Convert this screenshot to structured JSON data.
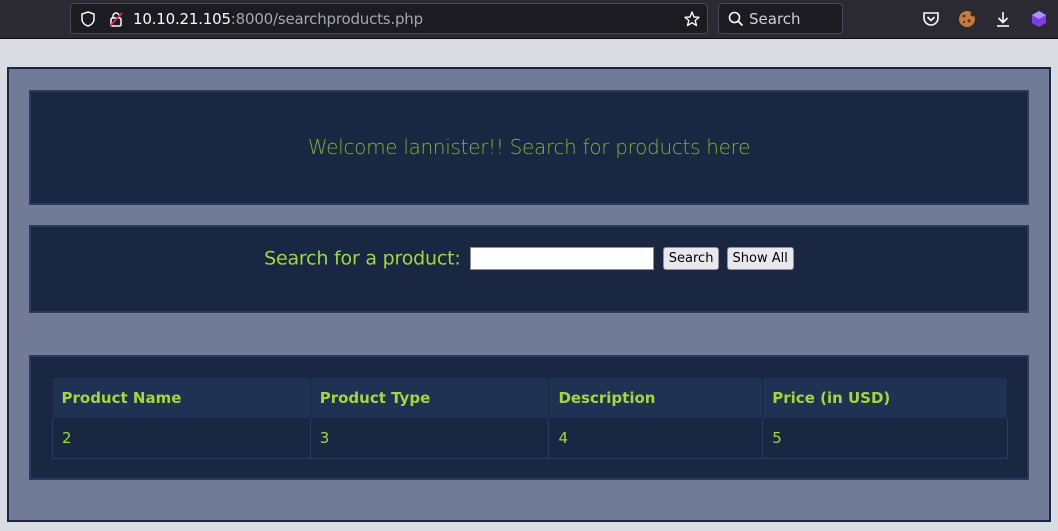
{
  "browser": {
    "url_host": "10.10.21.105",
    "url_rest": ":8000/searchproducts.php",
    "search_placeholder": "Search",
    "icons": [
      "shield-icon",
      "insecure-lock-icon",
      "bookmark-star-icon",
      "search-icon",
      "pocket-icon",
      "cookie-extension-icon",
      "download-icon",
      "extension-icon"
    ]
  },
  "page": {
    "welcome": "Welcome lannister!! Search for products here",
    "search_label": "Search for a product:",
    "search_value": "",
    "search_button": "Search",
    "show_all_button": "Show All",
    "table": {
      "headers": [
        "Product Name",
        "Product Type",
        "Description",
        "Price (in USD)"
      ],
      "rows": [
        [
          "2",
          "3",
          "4",
          "5"
        ]
      ]
    }
  },
  "colors": {
    "accent_text": "#a1d83c",
    "welcome_text": "#7eb237",
    "panel_bg": "#1a2742",
    "page_bg": "#717b96"
  }
}
